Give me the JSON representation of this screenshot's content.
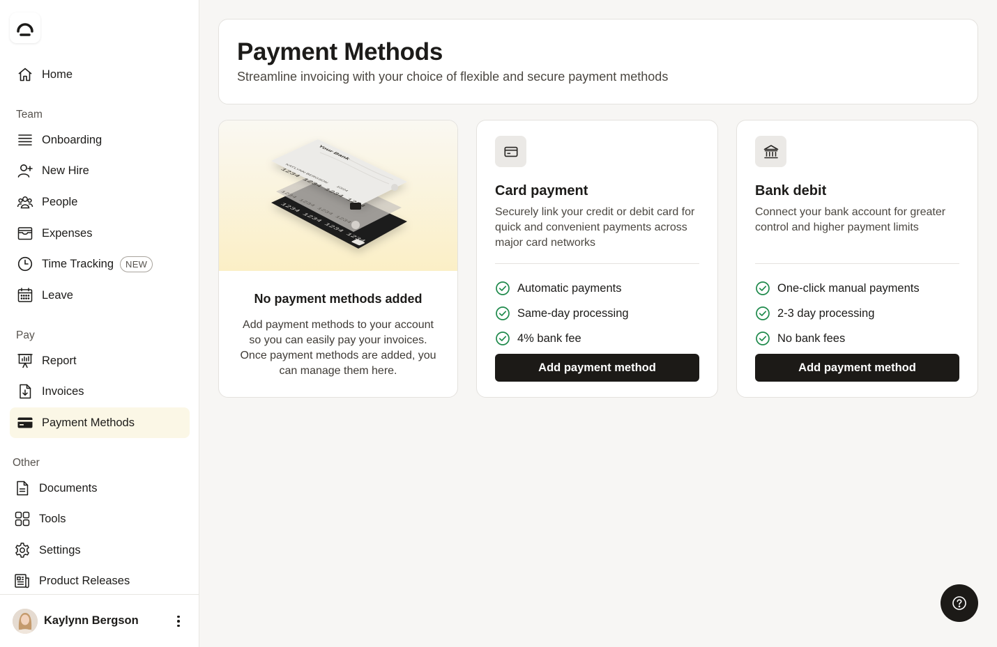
{
  "sidebar": {
    "home": "Home",
    "team_label": "Team",
    "team_items": [
      "Onboarding",
      "New Hire",
      "People",
      "Expenses",
      "Time Tracking",
      "Leave"
    ],
    "time_tracking_badge": "NEW",
    "pay_label": "Pay",
    "pay_items": [
      "Report",
      "Invoices",
      "Payment Methods"
    ],
    "other_label": "Other",
    "other_items": [
      "Documents",
      "Tools",
      "Settings",
      "Product Releases"
    ],
    "active_item": "Payment Methods",
    "user_name": "Kaylynn Bergson"
  },
  "header": {
    "title": "Payment Methods",
    "subtitle": "Streamline invoicing with your choice of flexible and secure payment methods"
  },
  "empty_state": {
    "title": "No payment methods added",
    "body": "Add payment methods to your account so you can easily pay your invoices. Once payment methods are added, you can manage them here.",
    "illustration": {
      "bank_name": "Your Bank",
      "card_number": "1234 1234 1234 1234",
      "cardholder": "KAYLYNN BERGSON",
      "expiry": "10/24"
    }
  },
  "card_payment": {
    "icon": "credit-card-icon",
    "title": "Card payment",
    "description": "Securely link your credit or debit card for quick and convenient payments across major card networks",
    "features": [
      "Automatic payments",
      "Same-day processing",
      "4% bank fee"
    ],
    "cta": "Add payment method"
  },
  "bank_debit": {
    "icon": "bank-icon",
    "title": "Bank debit",
    "description": "Connect your bank account for greater control and higher payment limits",
    "features": [
      "One-click manual payments",
      "2-3 day processing",
      "No bank fees"
    ],
    "cta": "Add payment method"
  },
  "colors": {
    "accent_dark": "#1c1a17",
    "check_green": "#1f8a4c",
    "active_bg": "#fbf7e6"
  }
}
